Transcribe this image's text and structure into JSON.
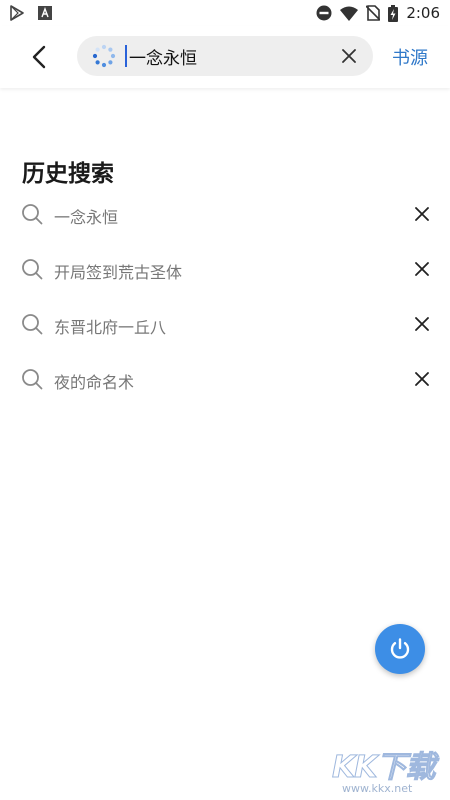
{
  "status_bar": {
    "time": "2:06",
    "icons": [
      "play-store-icon",
      "app-notification-icon",
      "do-not-disturb-icon",
      "wifi-icon",
      "no-sim-icon",
      "battery-charging-icon"
    ]
  },
  "header": {
    "back_icon": "back-arrow-icon",
    "search": {
      "loading_icon": "loading-spinner-icon",
      "value": "一念永恒",
      "clear_icon": "close-icon"
    },
    "source_label": "书源",
    "accent": "#2f78c9"
  },
  "history": {
    "title": "历史搜索",
    "items": [
      {
        "text": "一念永恒"
      },
      {
        "text": "开局签到荒古圣体"
      },
      {
        "text": "东晋北府一丘八"
      },
      {
        "text": "夜的命名术"
      }
    ]
  },
  "fab": {
    "icon": "power-icon",
    "color": "#3d8ee6"
  },
  "watermark": {
    "logo": "KK下载",
    "url": "www.kkx.net"
  }
}
